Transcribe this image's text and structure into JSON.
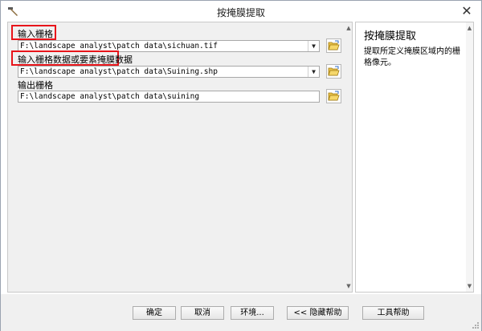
{
  "window": {
    "title": "按掩膜提取"
  },
  "form": {
    "input_raster": {
      "label": "输入栅格",
      "value": "F:\\landscape analyst\\patch data\\sichuan.tif"
    },
    "mask": {
      "label": "输入栅格数据或要素掩膜数据",
      "value": "F:\\landscape analyst\\patch data\\Suining.shp"
    },
    "output_raster": {
      "label": "输出栅格",
      "value": "F:\\landscape analyst\\patch data\\suining"
    }
  },
  "help": {
    "title": "按掩膜提取",
    "text": "提取所定义掩膜区域内的栅格像元。"
  },
  "buttons": {
    "ok": "确定",
    "cancel": "取消",
    "environments": "环境...",
    "hide_help": "<< 隐藏帮助",
    "tool_help": "工具帮助"
  },
  "colors": {
    "highlight": "#e8141a",
    "pane_bg": "#f0f0f0"
  },
  "icons": {
    "app": "hammer-icon",
    "close": "close-icon",
    "browse": "folder-open-icon",
    "dropdown": "chevron-down-icon"
  }
}
